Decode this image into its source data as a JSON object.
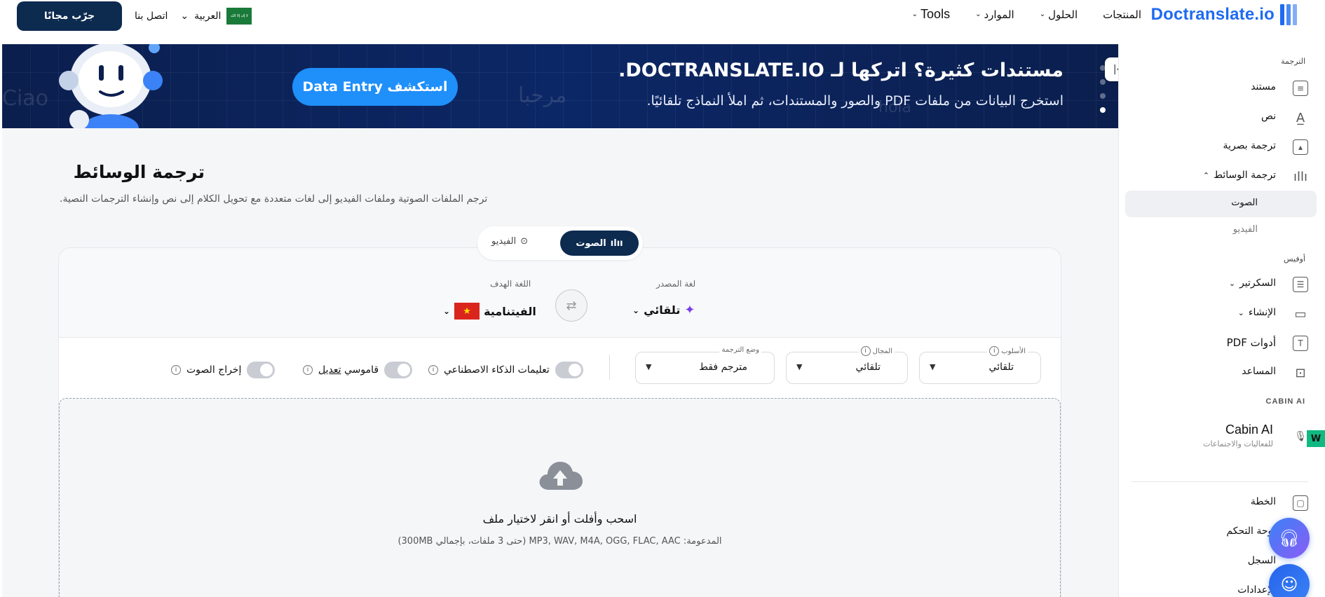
{
  "topbar": {
    "logo": "Doctranslate.io",
    "nav": [
      {
        "label": "المنتجات",
        "has_chevron": false
      },
      {
        "label": "الحلول",
        "has_chevron": true
      },
      {
        "label": "الموارد",
        "has_chevron": true
      },
      {
        "label": "Tools",
        "has_chevron": true
      }
    ],
    "language": "العربية",
    "contact": "اتصل بنا",
    "try_free": "جرّب مجانًا",
    "flag_text": "لا إله إلا الله"
  },
  "banner": {
    "title": "مستندات كثيرة؟ اتركها لـ DOCTRANSLATE.IO.",
    "subtitle": "استخرج البيانات من ملفات PDF والصور والمستندات، ثم املأ النماذج تلقائيًا.",
    "cta": "استكشف Data Entry",
    "ghost_words": [
      "Ciao",
      "مرحبا",
      "hola"
    ]
  },
  "main": {
    "title": "ترجمة الوسائط",
    "subtitle": "ترجم الملفات الصوتية وملفات الفيديو إلى لغات متعددة مع تحويل الكلام إلى نص وإنشاء الترجمات النصية.",
    "tabs": {
      "audio": "الصوت",
      "video": "الفيديو"
    },
    "source_label": "لغة المصدر",
    "source_value": "تلقائي",
    "target_label": "اللغة الهدف",
    "target_value": "الفيتنامية",
    "options": {
      "style": {
        "caption": "الأسلوب",
        "value": "تلقائي"
      },
      "domain": {
        "caption": "المجال",
        "value": "تلقائي"
      },
      "mode": {
        "caption": "وضع الترجمة",
        "value": "مترجم فقط"
      }
    },
    "toggles": {
      "ai_instructions": "تعليمات الذكاء الاصطناعي",
      "dictionary_prefix": "قاموسي",
      "dictionary_link": "تعديل",
      "audio_output": "إخراج الصوت"
    },
    "dropzone": {
      "title": "اسحب وأفلت أو انقر لاختيار ملف",
      "supported": "المدعومة: MP3, WAV, M4A, OGG, FLAC, AAC (حتى 3 ملفات، بإجمالي 300MB)"
    }
  },
  "sidebar": {
    "section_translation": "الترجمة",
    "items": {
      "document": "مستند",
      "text": "نص",
      "visual": "ترجمة بصرية",
      "media": "ترجمة الوسائط",
      "audio": "الصوت",
      "video": "الفيديو"
    },
    "section_office": "أوفيس",
    "office": {
      "secretary": "السكرتير",
      "create": "الإنشاء",
      "pdf_tools": "أدوات PDF",
      "assistant": "المساعد"
    },
    "section_cabin": "CABIN AI",
    "cabin": {
      "title": "Cabin AI",
      "subtitle": "للفعاليات والاجتماعات"
    },
    "account": {
      "plan": "الخطة",
      "dashboard": "لوحة التحكم",
      "history": "السجل",
      "settings": "الإعدادات"
    }
  }
}
